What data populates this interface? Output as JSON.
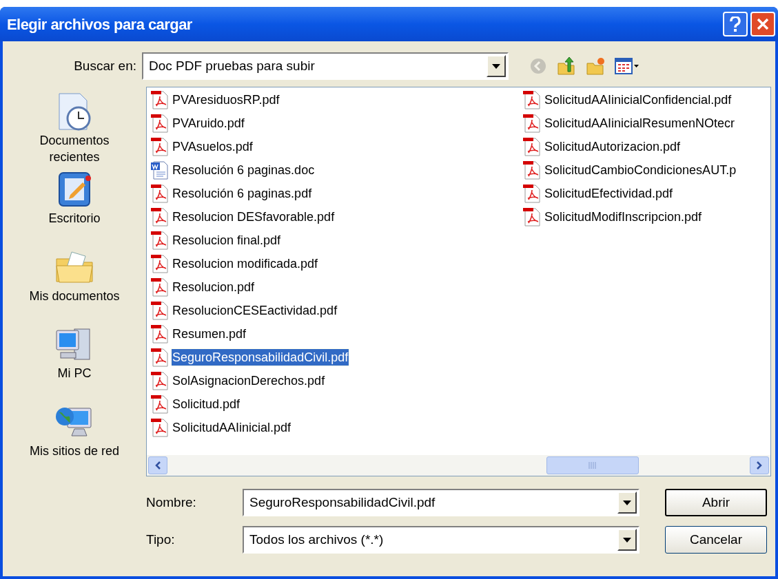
{
  "window": {
    "title": "Elegir archivos para cargar"
  },
  "look_in": {
    "label": "Buscar en:",
    "value": "Doc PDF pruebas para subir"
  },
  "toolbar": [
    {
      "kind": "back",
      "disabled": true
    },
    {
      "kind": "up",
      "disabled": false
    },
    {
      "kind": "new-folder",
      "disabled": false
    },
    {
      "kind": "views",
      "disabled": false
    }
  ],
  "places": [
    {
      "kind": "recent",
      "label": "Documentos recientes"
    },
    {
      "kind": "desktop",
      "label": "Escritorio"
    },
    {
      "kind": "documents",
      "label": "Mis documentos"
    },
    {
      "kind": "computer",
      "label": "Mi PC"
    },
    {
      "kind": "network",
      "label": "Mis sitios de red"
    }
  ],
  "files": [
    {
      "name": "PVAresiduosRP.pdf",
      "kind": "pdf",
      "selected": false
    },
    {
      "name": "PVAruido.pdf",
      "kind": "pdf",
      "selected": false
    },
    {
      "name": "PVAsuelos.pdf",
      "kind": "pdf",
      "selected": false
    },
    {
      "name": "Resolución 6 paginas.doc",
      "kind": "doc",
      "selected": false
    },
    {
      "name": "Resolución 6 paginas.pdf",
      "kind": "pdf",
      "selected": false
    },
    {
      "name": "Resolucion DESfavorable.pdf",
      "kind": "pdf",
      "selected": false
    },
    {
      "name": "Resolucion final.pdf",
      "kind": "pdf",
      "selected": false
    },
    {
      "name": "Resolucion modificada.pdf",
      "kind": "pdf",
      "selected": false
    },
    {
      "name": "Resolucion.pdf",
      "kind": "pdf",
      "selected": false
    },
    {
      "name": "ResolucionCESEactividad.pdf",
      "kind": "pdf",
      "selected": false
    },
    {
      "name": "Resumen.pdf",
      "kind": "pdf",
      "selected": false
    },
    {
      "name": "SeguroResponsabilidadCivil.pdf",
      "kind": "pdf",
      "selected": true
    },
    {
      "name": "SolAsignacionDerechos.pdf",
      "kind": "pdf",
      "selected": false
    },
    {
      "name": "Solicitud.pdf",
      "kind": "pdf",
      "selected": false
    },
    {
      "name": "SolicitudAAIinicial.pdf",
      "kind": "pdf",
      "selected": false
    },
    {
      "name": "SolicitudAAIinicialConfidencial.pdf",
      "kind": "pdf",
      "selected": false
    },
    {
      "name": "SolicitudAAIinicialResumenNOtecr",
      "kind": "pdf",
      "selected": false
    },
    {
      "name": "SolicitudAutorizacion.pdf",
      "kind": "pdf",
      "selected": false
    },
    {
      "name": "SolicitudCambioCondicionesAUT.p",
      "kind": "pdf",
      "selected": false
    },
    {
      "name": "SolicitudEfectividad.pdf",
      "kind": "pdf",
      "selected": false
    },
    {
      "name": "SolicitudModifInscripcion.pdf",
      "kind": "pdf",
      "selected": false
    }
  ],
  "file_name": {
    "label": "Nombre:",
    "value": "SeguroResponsabilidadCivil.pdf"
  },
  "file_type": {
    "label": "Tipo:",
    "value": "Todos los archivos (*.*)"
  },
  "buttons": [
    {
      "label": "Abrir",
      "default": true
    },
    {
      "label": "Cancelar",
      "default": false
    }
  ]
}
